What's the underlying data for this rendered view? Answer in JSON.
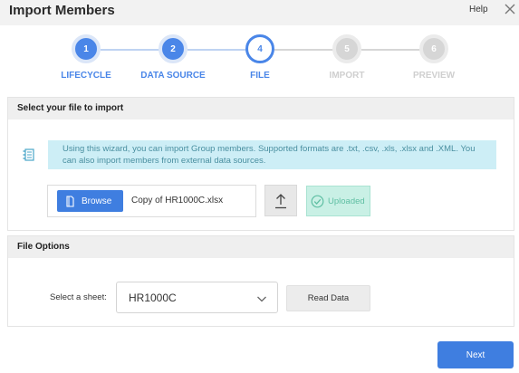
{
  "header": {
    "title": "Import Members",
    "help_label": "Help",
    "close_icon": "close-icon"
  },
  "steps": [
    {
      "number": "1",
      "label": "LIFECYCLE",
      "state": "done"
    },
    {
      "number": "2",
      "label": "DATA SOURCE",
      "state": "done"
    },
    {
      "number": "4",
      "label": "FILE",
      "state": "current"
    },
    {
      "number": "5",
      "label": "IMPORT",
      "state": "todo"
    },
    {
      "number": "6",
      "label": "PREVIEW",
      "state": "todo"
    }
  ],
  "select_file": {
    "header": "Select your file to import",
    "info_icon": "list-icon",
    "info_text": "Using this wizard, you can import Group members. Supported formats are .txt, .csv, .xls, .xlsx and .XML. You can also import members from external data sources.",
    "browse_label": "Browse",
    "file_name": "Copy of HR1000C.xlsx",
    "upload_icon": "upload-icon",
    "status_label": "Uploaded"
  },
  "file_options": {
    "header": "File Options",
    "sheet_label": "Select a sheet:",
    "sheet_value": "HR1000C",
    "read_data_label": "Read Data"
  },
  "footer": {
    "next_label": "Next"
  },
  "colors": {
    "accent": "#4a86e8",
    "button_blue": "#3f7ee0",
    "info_bg": "#cdeef6",
    "success_bg": "#c9f0e5",
    "success_text": "#5fbfa3"
  }
}
